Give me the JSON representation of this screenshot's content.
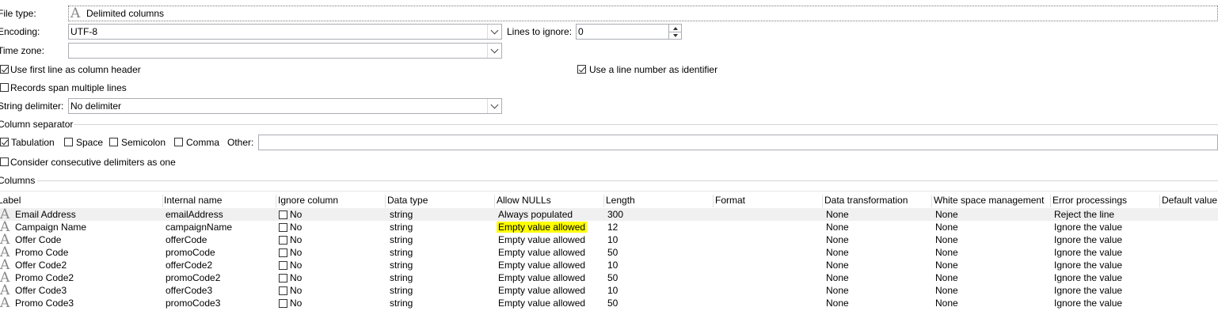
{
  "form": {
    "file_type_label": "File type:",
    "file_type_value": "Delimited columns",
    "encoding_label": "Encoding:",
    "encoding_value": "UTF-8",
    "lines_to_ignore_label": "Lines to ignore:",
    "lines_to_ignore_value": "0",
    "time_zone_label": "Time zone:",
    "time_zone_value": "",
    "use_first_line_label": "Use first line as column header",
    "use_first_line_checked": true,
    "use_line_number_label": "Use a line number as identifier",
    "use_line_number_checked": true,
    "records_span_label": "Records span multiple lines",
    "records_span_checked": false,
    "string_delimiter_label": "String delimiter:",
    "string_delimiter_value": "No delimiter"
  },
  "column_separator": {
    "title": "Column separator",
    "tabulation_label": "Tabulation",
    "space_label": "Space",
    "semicolon_label": "Semicolon",
    "comma_label": "Comma",
    "other_label": "Other:",
    "other_value": "",
    "consecutive_label": "Consider consecutive delimiters as one"
  },
  "columns": {
    "title": "Columns",
    "headers": [
      "Label",
      "Internal name",
      "Ignore column",
      "Data type",
      "Allow NULLs",
      "Length",
      "Format",
      "Data transformation",
      "White space management",
      "Error processings",
      "Default value"
    ],
    "rows": [
      {
        "label": "Email Address",
        "internal": "emailAddress",
        "ignore": "No",
        "type": "string",
        "nulls": "Always populated",
        "length": "300",
        "format": "",
        "transform": "None",
        "whitespace": "None",
        "error": "Reject the line",
        "default": ""
      },
      {
        "label": "Campaign Name",
        "internal": "campaignName",
        "ignore": "No",
        "type": "string",
        "nulls": "Empty value allowed",
        "length": "12",
        "format": "",
        "transform": "None",
        "whitespace": "None",
        "error": "Ignore the value",
        "default": ""
      },
      {
        "label": "Offer Code",
        "internal": "offerCode",
        "ignore": "No",
        "type": "string",
        "nulls": "Empty value allowed",
        "length": "10",
        "format": "",
        "transform": "None",
        "whitespace": "None",
        "error": "Ignore the value",
        "default": ""
      },
      {
        "label": "Promo Code",
        "internal": "promoCode",
        "ignore": "No",
        "type": "string",
        "nulls": "Empty value allowed",
        "length": "50",
        "format": "",
        "transform": "None",
        "whitespace": "None",
        "error": "Ignore the value",
        "default": ""
      },
      {
        "label": "Offer Code2",
        "internal": "offerCode2",
        "ignore": "No",
        "type": "string",
        "nulls": "Empty value allowed",
        "length": "10",
        "format": "",
        "transform": "None",
        "whitespace": "None",
        "error": "Ignore the value",
        "default": ""
      },
      {
        "label": "Promo Code2",
        "internal": "promoCode2",
        "ignore": "No",
        "type": "string",
        "nulls": "Empty value allowed",
        "length": "50",
        "format": "",
        "transform": "None",
        "whitespace": "None",
        "error": "Ignore the value",
        "default": ""
      },
      {
        "label": "Offer Code3",
        "internal": "offerCode3",
        "ignore": "No",
        "type": "string",
        "nulls": "Empty value allowed",
        "length": "10",
        "format": "",
        "transform": "None",
        "whitespace": "None",
        "error": "Ignore the value",
        "default": ""
      },
      {
        "label": "Promo Code3",
        "internal": "promoCode3",
        "ignore": "No",
        "type": "string",
        "nulls": "Empty value allowed",
        "length": "50",
        "format": "",
        "transform": "None",
        "whitespace": "None",
        "error": "Ignore the value",
        "default": ""
      }
    ]
  },
  "highlight_color": "#ffff00"
}
